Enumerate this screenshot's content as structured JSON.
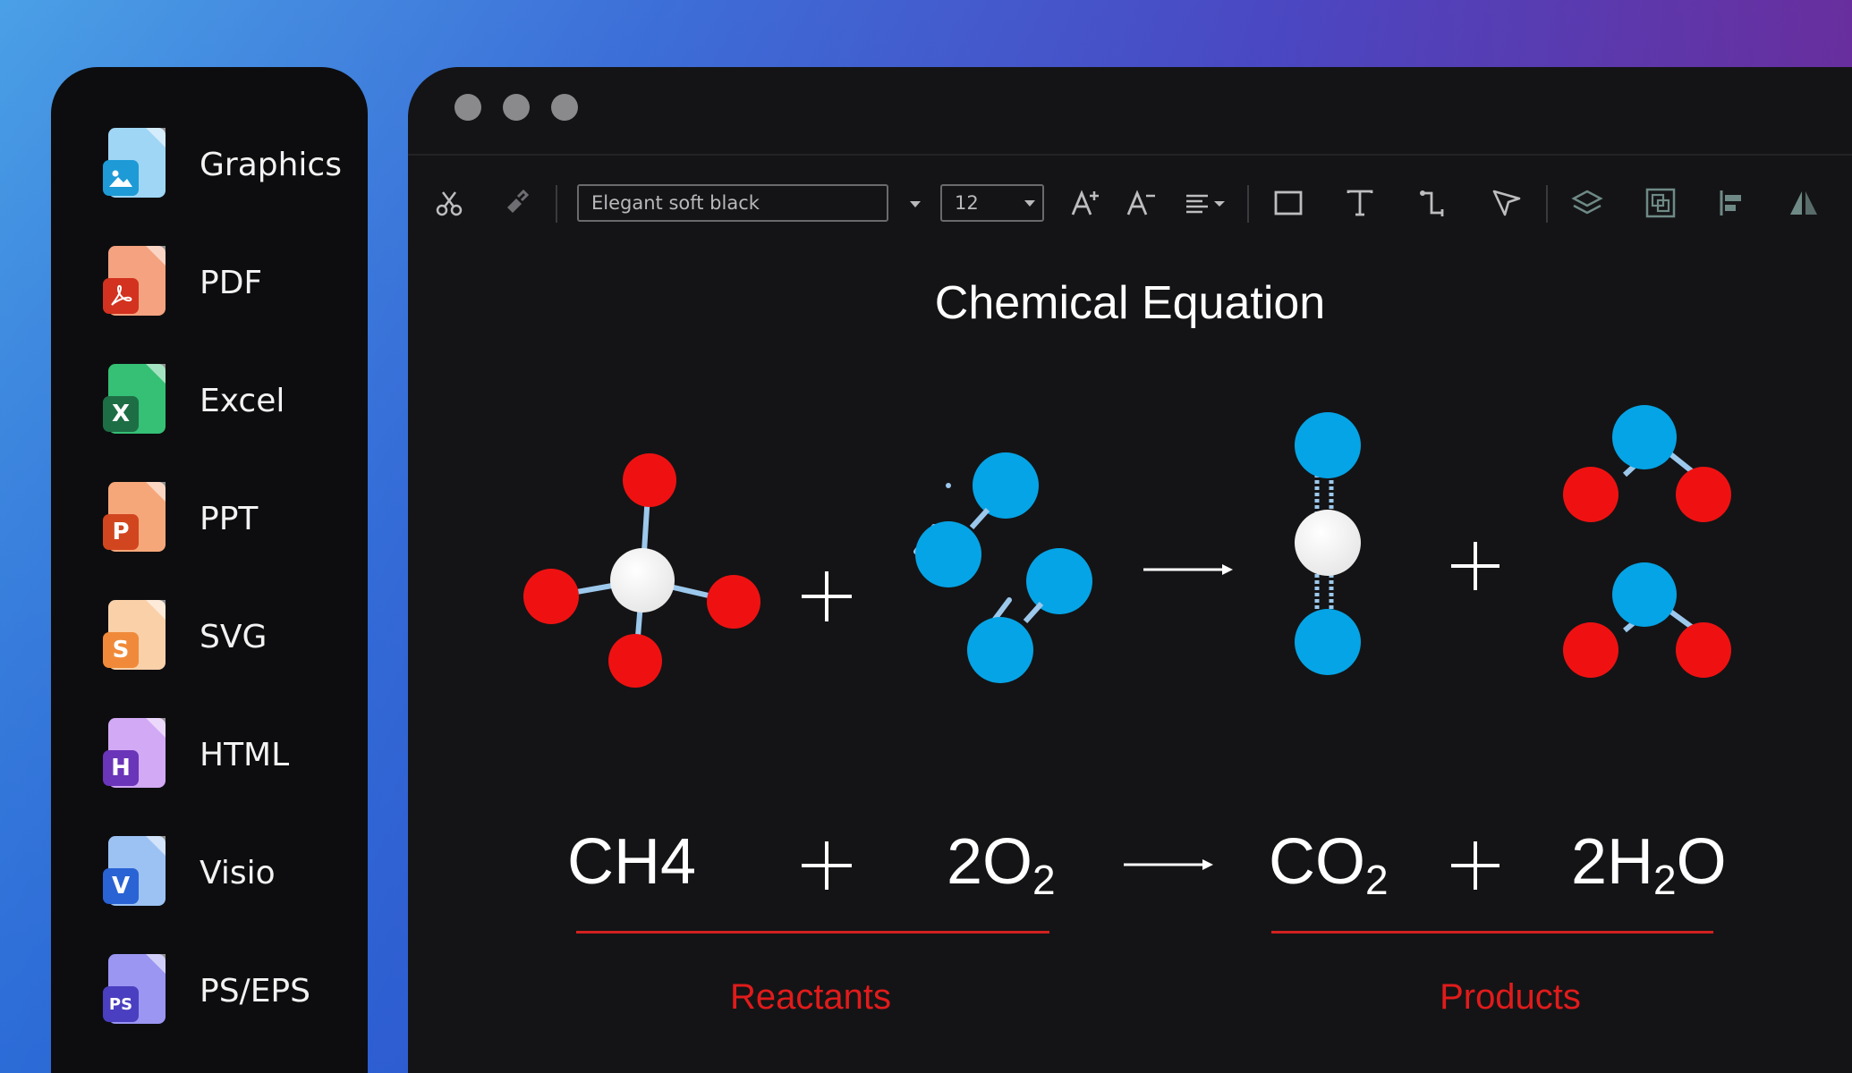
{
  "sidebar": {
    "items": [
      {
        "label": "Graphics",
        "icon": "image-file-icon",
        "badge": "",
        "color": "#5ab7ea",
        "badge_color": "#1e9ad6"
      },
      {
        "label": "PDF",
        "icon": "pdf-file-icon",
        "badge": "",
        "color": "#f28a6b",
        "badge_color": "#d2321f"
      },
      {
        "label": "Excel",
        "icon": "excel-file-icon",
        "badge": "X",
        "color": "#2fb36b",
        "badge_color": "#1e6e45"
      },
      {
        "label": "PPT",
        "icon": "ppt-file-icon",
        "badge": "P",
        "color": "#f49a6a",
        "badge_color": "#d2461f"
      },
      {
        "label": "SVG",
        "icon": "svg-file-icon",
        "badge": "S",
        "color": "#f8c497",
        "badge_color": "#f08a3a"
      },
      {
        "label": "HTML",
        "icon": "html-file-icon",
        "badge": "H",
        "color": "#c79af0",
        "badge_color": "#6a35b8"
      },
      {
        "label": "Visio",
        "icon": "visio-file-icon",
        "badge": "V",
        "color": "#8fb8f2",
        "badge_color": "#2a63d4"
      },
      {
        "label": "PS/EPS",
        "icon": "ps-eps-file-icon",
        "badge": "PS",
        "color": "#8c88f0",
        "badge_color": "#4a3fc0"
      }
    ]
  },
  "toolbar": {
    "font_name": "Elegant soft black",
    "font_size": "12"
  },
  "canvas": {
    "title": "Chemical Equation",
    "equation": {
      "term1": "CH4",
      "plus1": "+",
      "term2_main": "2O",
      "term2_sub": "2",
      "term3_main": "CO",
      "term3_sub": "2",
      "plus2": "+",
      "term4_a": "2H",
      "term4_sub": "2",
      "term4_b": "O"
    },
    "reactants_label": "Reactants",
    "products_label": "Products"
  },
  "colors": {
    "atom_red": "#ef1111",
    "atom_blue": "#05a4e6",
    "atom_white": "#ffffff",
    "bond": "#9cc8ec",
    "label_red": "#e11b1b"
  }
}
